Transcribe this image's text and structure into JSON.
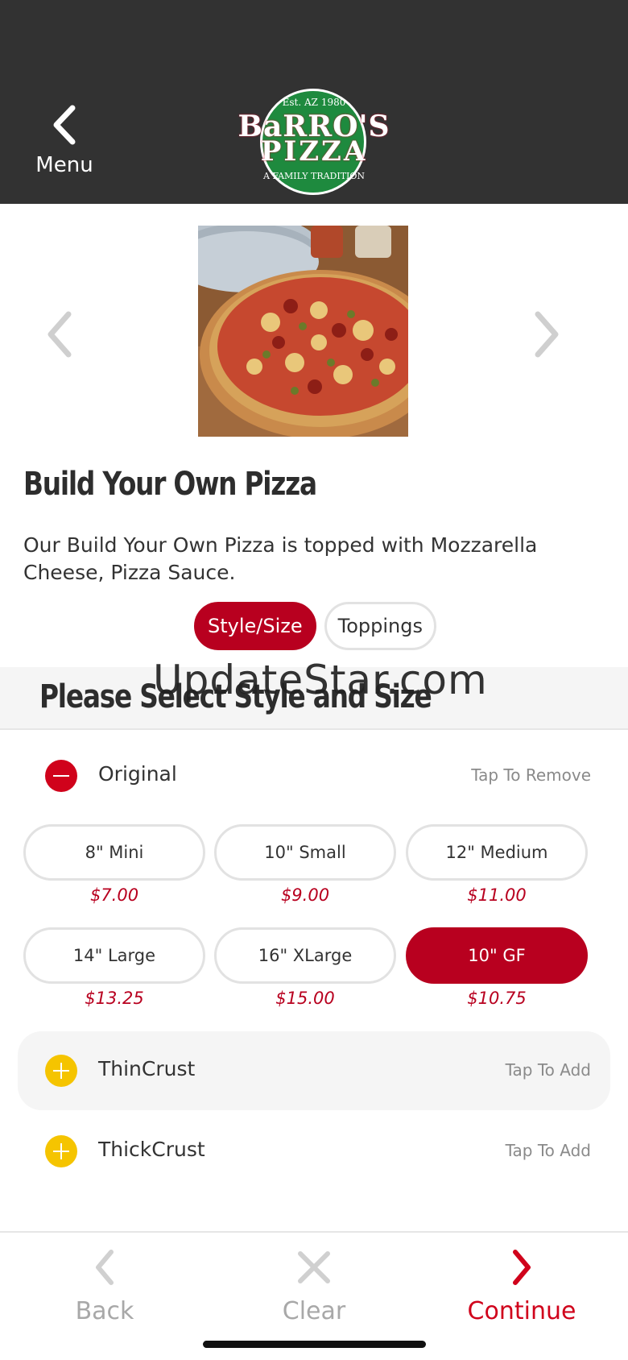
{
  "header": {
    "back_label": "Menu",
    "logo": {
      "est": "Est. AZ 1980",
      "line1": "BaRRO'S",
      "line2": "PIZZA",
      "tagline": "A FAMILY TRADITION"
    }
  },
  "product": {
    "title": "Build Your Own Pizza",
    "description": "Our Build Your Own Pizza is topped with Mozzarella Cheese, Pizza Sauce."
  },
  "tabs": [
    {
      "label": "Style/Size",
      "active": true
    },
    {
      "label": "Toppings",
      "active": false
    }
  ],
  "section": {
    "title": "Please Select Style and Size"
  },
  "watermark": "UpdateStar.com",
  "options": [
    {
      "label": "Original",
      "action": "Tap To Remove",
      "state": "selected"
    },
    {
      "label": "ThinCrust",
      "action": "Tap To Add",
      "state": "unselected"
    },
    {
      "label": "ThickCrust",
      "action": "Tap To Add",
      "state": "unselected"
    }
  ],
  "sizes": [
    {
      "label": "8\" Mini",
      "price": "$7.00",
      "selected": false
    },
    {
      "label": "10\" Small",
      "price": "$9.00",
      "selected": false
    },
    {
      "label": "12\" Medium",
      "price": "$11.00",
      "selected": false
    },
    {
      "label": "14\" Large",
      "price": "$13.25",
      "selected": false
    },
    {
      "label": "16\" XLarge",
      "price": "$15.00",
      "selected": false
    },
    {
      "label": "10\" GF",
      "price": "$10.75",
      "selected": true
    }
  ],
  "bottom_nav": {
    "back": "Back",
    "clear": "Clear",
    "continue": "Continue"
  },
  "colors": {
    "header_bg": "#323232",
    "accent_red": "#b8001f",
    "add_yellow": "#f5c400",
    "remove_red": "#d0021b"
  },
  "icons": {
    "back": "chevron-left-icon",
    "carousel_prev": "chevron-left-icon",
    "carousel_next": "chevron-right-icon",
    "remove": "minus-circle-icon",
    "add": "plus-circle-icon",
    "clear": "close-icon",
    "continue": "chevron-right-icon"
  }
}
